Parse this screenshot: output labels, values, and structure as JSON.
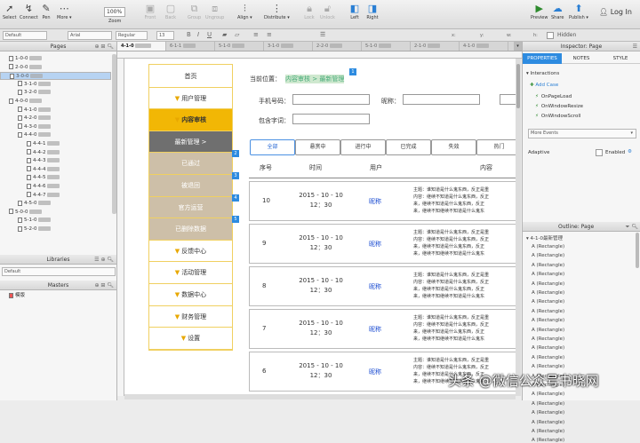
{
  "toolbar": {
    "items": [
      {
        "label": "Select",
        "icon": "cursor-icon"
      },
      {
        "label": "Connect",
        "icon": "connector-icon"
      },
      {
        "label": "Pen",
        "icon": "pen-icon"
      },
      {
        "label": "More ▾",
        "icon": "more-icon"
      },
      {
        "label": "Front",
        "icon": "front-icon"
      },
      {
        "label": "Back",
        "icon": "back-icon"
      },
      {
        "label": "Group",
        "icon": "group-icon"
      },
      {
        "label": "Ungroup",
        "icon": "ungroup-icon"
      },
      {
        "label": "Align ▾",
        "icon": "align-icon"
      },
      {
        "label": "Distribute ▾",
        "icon": "distribute-icon"
      },
      {
        "label": "Lock",
        "icon": "lock-icon"
      },
      {
        "label": "Unlock",
        "icon": "unlock-icon"
      },
      {
        "label": "Left",
        "icon": "left-panel-icon"
      },
      {
        "label": "Right",
        "icon": "right-panel-icon"
      },
      {
        "label": "Preview",
        "icon": "preview-icon"
      },
      {
        "label": "Share",
        "icon": "share-icon"
      },
      {
        "label": "Publish ▾",
        "icon": "publish-icon"
      }
    ],
    "zoom_value": "100%",
    "zoom_label": "Zoom",
    "login": "Log In"
  },
  "format_bar": {
    "style": "Default",
    "font": "Arial",
    "weight": "Regular",
    "size": "13",
    "x_label": "x:",
    "y_label": "y:",
    "w_label": "w:",
    "h_label": "h:",
    "hidden_label": "Hidden"
  },
  "tabs": [
    "4-1-0",
    "6-1-1",
    "5-1-0",
    "3-1-0",
    "2-2-0",
    "5-1-0",
    "2-1-0",
    "4-1-0"
  ],
  "pages": {
    "title": "Pages",
    "items": [
      {
        "label": "1-0-0",
        "indent": 0
      },
      {
        "label": "2-0-0",
        "indent": 0
      },
      {
        "label": "3-0-0",
        "indent": 0,
        "selected": true
      },
      {
        "label": "3-1-0",
        "indent": 1
      },
      {
        "label": "3-2-0",
        "indent": 1
      },
      {
        "label": "4-0-0",
        "indent": 0
      },
      {
        "label": "4-1-0",
        "indent": 1
      },
      {
        "label": "4-2-0",
        "indent": 1
      },
      {
        "label": "4-3-0",
        "indent": 1
      },
      {
        "label": "4-4-0",
        "indent": 1
      },
      {
        "label": "4-4-1",
        "indent": 2
      },
      {
        "label": "4-4-2",
        "indent": 2
      },
      {
        "label": "4-4-3",
        "indent": 2
      },
      {
        "label": "4-4-4",
        "indent": 2
      },
      {
        "label": "4-4-5",
        "indent": 2
      },
      {
        "label": "4-4-6",
        "indent": 2
      },
      {
        "label": "4-4-7",
        "indent": 2
      },
      {
        "label": "4-5-0",
        "indent": 1
      },
      {
        "label": "5-0-0",
        "indent": 0
      },
      {
        "label": "5-1-0",
        "indent": 1
      },
      {
        "label": "5-2-0",
        "indent": 1
      }
    ]
  },
  "libraries": {
    "title": "Libraries",
    "selected": "Default"
  },
  "masters": {
    "title": "Masters",
    "items": [
      "模版"
    ]
  },
  "canvas": {
    "menu": [
      {
        "label": "首页",
        "style": "y"
      },
      {
        "label": "用户管理",
        "style": "y",
        "arrow": true
      },
      {
        "label": "内容审核",
        "style": "gold",
        "arrow": true
      },
      {
        "label": "最新管理 >",
        "style": "grey"
      },
      {
        "label": "已通过",
        "style": "tan",
        "badge": "2"
      },
      {
        "label": "被退回",
        "style": "tan",
        "badge": "3"
      },
      {
        "label": "官方运营",
        "style": "tan",
        "badge": "4"
      },
      {
        "label": "已删除数据",
        "style": "tan",
        "badge": "5"
      },
      {
        "label": "反馈中心",
        "style": "y",
        "arrow": true
      },
      {
        "label": "活动管理",
        "style": "y",
        "arrow": true
      },
      {
        "label": "数据中心",
        "style": "y",
        "arrow": true
      },
      {
        "label": "财务管理",
        "style": "y",
        "arrow": true
      },
      {
        "label": "设置",
        "style": "y",
        "arrow": true
      }
    ],
    "breadcrumb_label": "当前位置：",
    "breadcrumb_value": "内容审核 > 最新管理",
    "breadcrumb_badge": "1",
    "phone_label": "手机号码：",
    "nick_label": "昵称：",
    "keyword_label": "包含字词：",
    "filters": [
      "全部",
      "悬赏中",
      "进行中",
      "已完成",
      "失效",
      "热门"
    ],
    "columns": [
      "序号",
      "时间",
      "用户",
      "内容"
    ],
    "rows": [
      {
        "no": "10",
        "time1": "2015 - 10 - 10",
        "time2": "12：30",
        "user": "昵称"
      },
      {
        "no": "9",
        "time1": "2015 - 10 - 10",
        "time2": "12：30",
        "user": "昵称"
      },
      {
        "no": "8",
        "time1": "2015 - 10 - 10",
        "time2": "12：30",
        "user": "昵称"
      },
      {
        "no": "7",
        "time1": "2015 - 10 - 10",
        "time2": "12：30",
        "user": "昵称"
      },
      {
        "no": "6",
        "time1": "2015 - 10 - 10",
        "time2": "12：30",
        "user": "昵称"
      }
    ],
    "content_line1": "主题：谁知道是什么鬼东西，反正是重",
    "content_line2": "内容：继续不知道是什么鬼东西，反正",
    "content_line3": "来，继续不知道是什么鬼东西，反正",
    "content_line4": "来，继续不知继续不知道是什么鬼东"
  },
  "inspector": {
    "title": "Inspector: Page",
    "tabs": [
      "PROPERTIES",
      "NOTES",
      "STYLE"
    ],
    "interactions_label": "Interactions",
    "add_case": "Add Case",
    "events": [
      "OnPageLoad",
      "OnWindowResize",
      "OnWindowScroll"
    ],
    "more_events": "More Events",
    "adaptive_label": "Adaptive",
    "enabled_label": "Enabled",
    "outline_title": "Outline: Page",
    "outline_root": "4-1-0最新管理",
    "outline_item": "(Rectangle)"
  },
  "watermark": "头条 @微信公众号书晓网"
}
